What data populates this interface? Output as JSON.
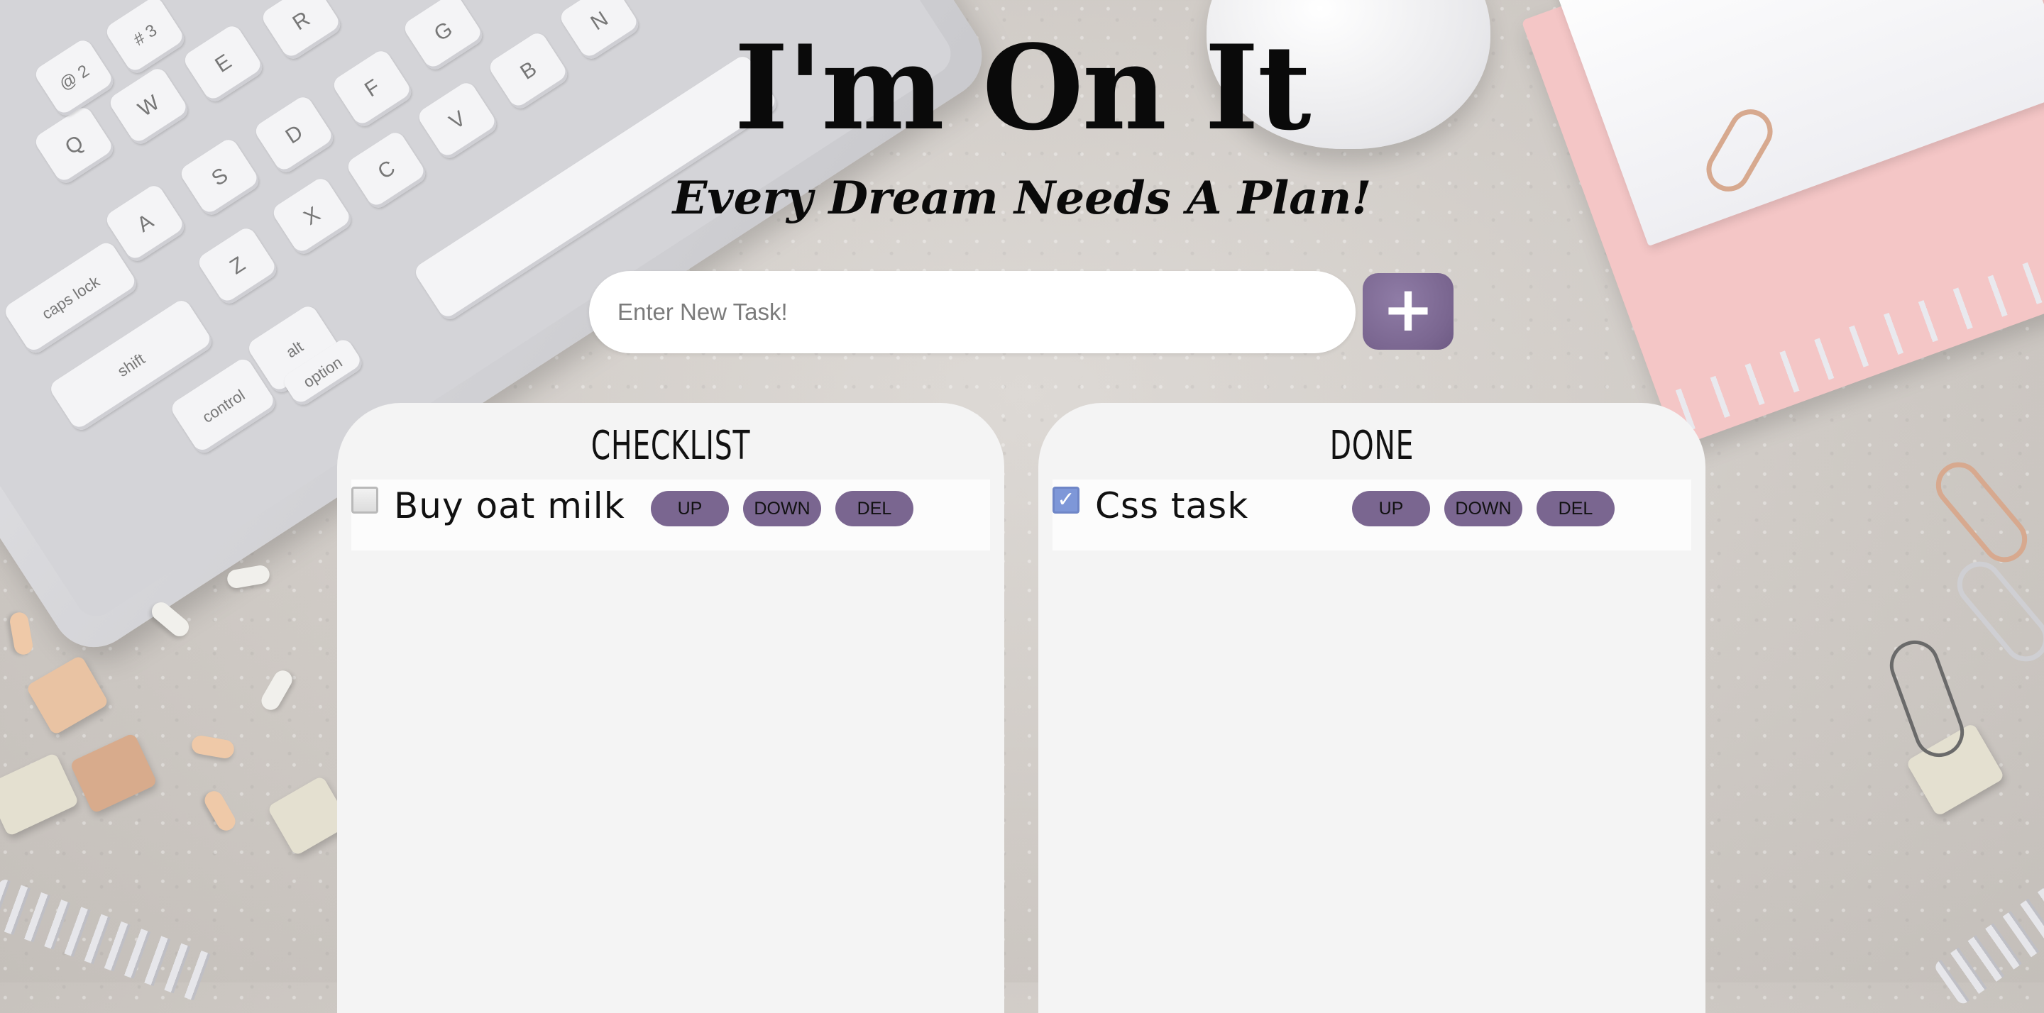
{
  "header": {
    "title": "I'm On It",
    "subtitle": "Every Dream Needs A Plan!"
  },
  "new_task": {
    "placeholder": "Enter New Task!",
    "value": "",
    "add_icon": "plus-icon",
    "add_label": "+"
  },
  "checklist": {
    "title": "CHECKLIST",
    "tasks": [
      {
        "text": "Buy oat milk",
        "checked": false,
        "up": "UP",
        "down": "DOWN",
        "del": "DEL"
      }
    ]
  },
  "done": {
    "title": "DONE",
    "tasks": [
      {
        "text": "Css task",
        "checked": true,
        "up": "UP",
        "down": "DOWN",
        "del": "DEL"
      }
    ]
  },
  "colors": {
    "accent": "#7a6690",
    "panel": "#f4f4f4",
    "checkbox_checked": "#7e97d8"
  },
  "keyboard_keys": {
    "caps_lock": "caps lock",
    "shift": "shift",
    "control": "control",
    "alt": "alt",
    "option": "option",
    "row": [
      "Q",
      "W",
      "E",
      "R",
      "A",
      "S",
      "D",
      "F",
      "G",
      "Z",
      "X",
      "C",
      "V",
      "B",
      "N"
    ],
    "num_2": "@ 2",
    "num_3": "# 3"
  }
}
